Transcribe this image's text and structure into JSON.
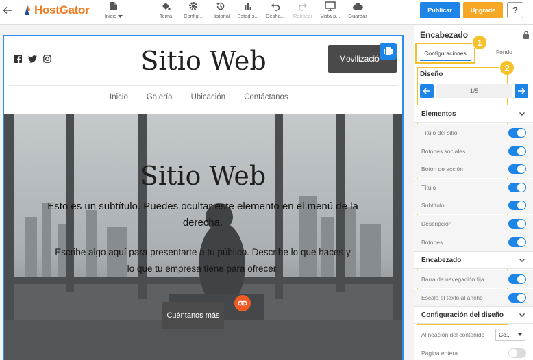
{
  "toolbar": {
    "logo": "HostGator",
    "tools": [
      {
        "label": "Inicio",
        "icon": "page-icon",
        "dropdown": true,
        "disabled": false
      },
      {
        "label": "Tema",
        "icon": "paint-bucket-icon",
        "disabled": false
      },
      {
        "label": "Config...",
        "icon": "gear-icon",
        "disabled": false
      },
      {
        "label": "Historial",
        "icon": "history-icon",
        "disabled": false
      },
      {
        "label": "Estadís...",
        "icon": "stats-icon",
        "disabled": false
      },
      {
        "label": "Desha...",
        "icon": "undo-icon",
        "disabled": false
      },
      {
        "label": "Rehacer",
        "icon": "redo-icon",
        "disabled": true
      },
      {
        "label": "Vista p...",
        "icon": "monitor-icon",
        "disabled": false
      },
      {
        "label": "Guardar",
        "icon": "cloud-icon",
        "disabled": false
      }
    ],
    "publish": "Publicar",
    "upgrade": "Upgrade",
    "help": "?",
    "colors": {
      "publish": "#1d84e8",
      "upgrade": "#f6a723",
      "brand": "#f47b20"
    }
  },
  "site": {
    "title": "Sitio Web",
    "header_button": "Movilizació",
    "nav": [
      "Inicio",
      "Galería",
      "Ubicación",
      "Contáctanos"
    ],
    "active_nav": "Inicio",
    "social": [
      "facebook-icon",
      "twitter-icon",
      "instagram-icon"
    ],
    "hero": {
      "title": "Sitio Web",
      "subtitle": "Esto es un subtítulo. Puedes ocultar este elemento en el menú de la derecha.",
      "description": "Escribe algo aquí para presentarte a tu público. Describe lo que haces y lo que tu empresa tiene para ofrecer.",
      "cta": "Cuéntanos más"
    }
  },
  "panel": {
    "title": "Encabezado",
    "tabs": [
      "Configuraciones",
      "Fondo"
    ],
    "active_tab": "Configuraciones",
    "markers": [
      "1",
      "2"
    ],
    "design": {
      "label": "Diseño",
      "page": "1/5"
    },
    "sections": [
      {
        "label": "Elementos",
        "rows": [
          {
            "label": "Título del sitio",
            "on": true
          },
          {
            "label": "Botones sociales",
            "on": true
          },
          {
            "label": "Botón de acción",
            "on": true
          },
          {
            "label": "Título",
            "on": true
          },
          {
            "label": "Subtítulo",
            "on": true
          },
          {
            "label": "Descripción",
            "on": true
          },
          {
            "label": "Botones",
            "on": true
          }
        ]
      },
      {
        "label": "Encabezado",
        "rows": [
          {
            "label": "Barra de navegación fija",
            "on": true
          },
          {
            "label": "Escala el texto al ancho",
            "on": true
          }
        ]
      },
      {
        "label": "Configuración del diseño",
        "rows": [
          {
            "label": "Alineación del contenido",
            "select": "Ce..."
          },
          {
            "label": "Página entera",
            "on": false
          }
        ]
      }
    ],
    "colors": {
      "highlight": "#f2c12b",
      "toggle_on": "#1d84e8"
    }
  }
}
